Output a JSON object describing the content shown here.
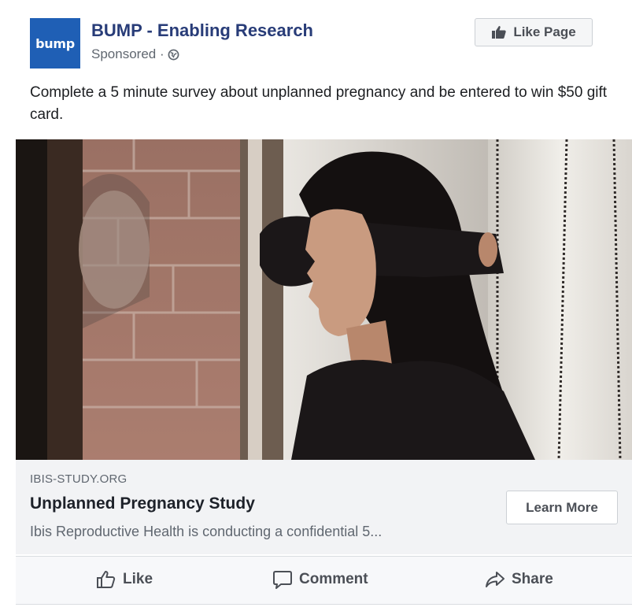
{
  "post": {
    "avatar_text": "bump",
    "page_name": "BUMP - Enabling Research",
    "sponsored": "Sponsored ·",
    "like_page_label": "Like Page",
    "message": "Complete a 5 minute survey about unplanned pregnancy and be entered to win $50 gift card."
  },
  "link": {
    "domain": "IBIS-STUDY.ORG",
    "headline": "Unplanned Pregnancy Study",
    "description": "Ibis Reproductive Health is conducting a confidential 5...",
    "cta_label": "Learn More"
  },
  "actions": {
    "like_label": "Like",
    "comment_label": "Comment",
    "share_label": "Share"
  },
  "colors": {
    "brand_blue": "#1f5fb5",
    "page_name": "#283c78"
  },
  "icons": [
    "globe-icon",
    "thumbs-up-icon",
    "like-icon",
    "comment-icon",
    "share-icon"
  ]
}
